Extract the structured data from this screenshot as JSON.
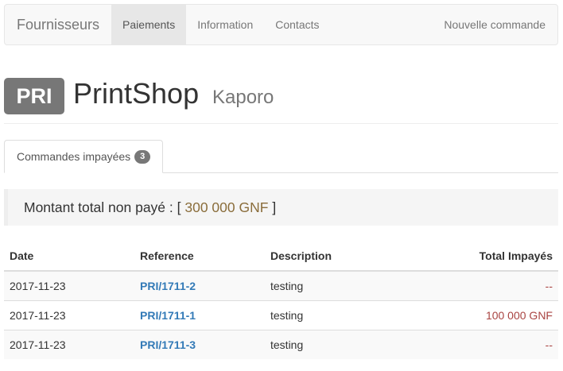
{
  "navbar": {
    "brand": "Fournisseurs",
    "items": [
      {
        "label": "Paiements",
        "active": true
      },
      {
        "label": "Information",
        "active": false
      },
      {
        "label": "Contacts",
        "active": false
      }
    ],
    "right_link": "Nouvelle commande"
  },
  "header": {
    "code": "PRI",
    "title": "PrintShop",
    "subtitle": "Kaporo"
  },
  "tabs": [
    {
      "label": "Commandes impayées",
      "count": "3"
    }
  ],
  "summary": {
    "label": "Montant total non payé : [",
    "value": "300 000 GNF",
    "suffix": "]"
  },
  "table": {
    "headers": [
      "Date",
      "Reference",
      "Description",
      "Total Impayés"
    ],
    "rows": [
      {
        "date": "2017-11-23",
        "reference": "PRI/1711-2",
        "description": "testing",
        "total": "--"
      },
      {
        "date": "2017-11-23",
        "reference": "PRI/1711-1",
        "description": "testing",
        "total": "100 000 GNF"
      },
      {
        "date": "2017-11-23",
        "reference": "PRI/1711-3",
        "description": "testing",
        "total": "--"
      }
    ]
  },
  "colors": {
    "badge": "#777777",
    "link": "#337ab7",
    "amount": "#a94442",
    "total_value": "#8a6d3b"
  }
}
